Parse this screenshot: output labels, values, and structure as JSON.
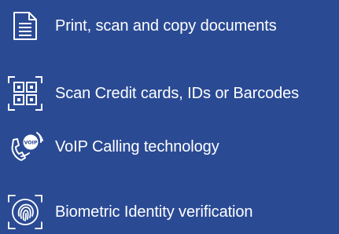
{
  "background_color": "#2a4a94",
  "text_color": "#ffffff",
  "features": [
    {
      "icon": "document-icon",
      "label": "Print, scan and copy documents"
    },
    {
      "icon": "qr-code-icon",
      "label": "Scan Credit cards, IDs or Barcodes"
    },
    {
      "icon": "voip-phone-icon",
      "label": "VoIP Calling technology"
    },
    {
      "icon": "fingerprint-icon",
      "label": "Biometric Identity verification"
    }
  ]
}
